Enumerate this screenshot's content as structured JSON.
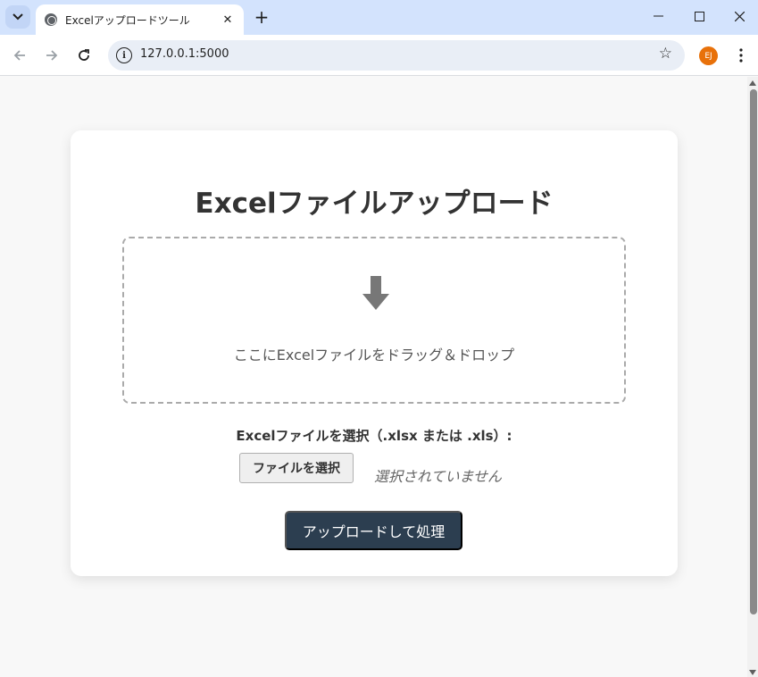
{
  "browser": {
    "tab_title": "Excelアップロードツール",
    "tab_close": "✕",
    "new_tab": "+",
    "url": "127.0.0.1:5000",
    "profile_initials": "EJ",
    "profile_color": "#e8710a",
    "window_controls": {
      "minimize": "—",
      "maximize": "☐",
      "close": "✕"
    }
  },
  "page": {
    "title": "Excelファイルアップロード",
    "dropzone": {
      "icon": "down-arrow-icon",
      "text": "ここにExcelファイルをドラッグ＆ドロップ"
    },
    "file_input": {
      "label": "Excelファイルを選択（.xlsx または .xls）:",
      "button_label": "ファイルを選択",
      "status": "選択されていません"
    },
    "submit_label": "アップロードして処理",
    "submit_color": "#2c3e50"
  }
}
